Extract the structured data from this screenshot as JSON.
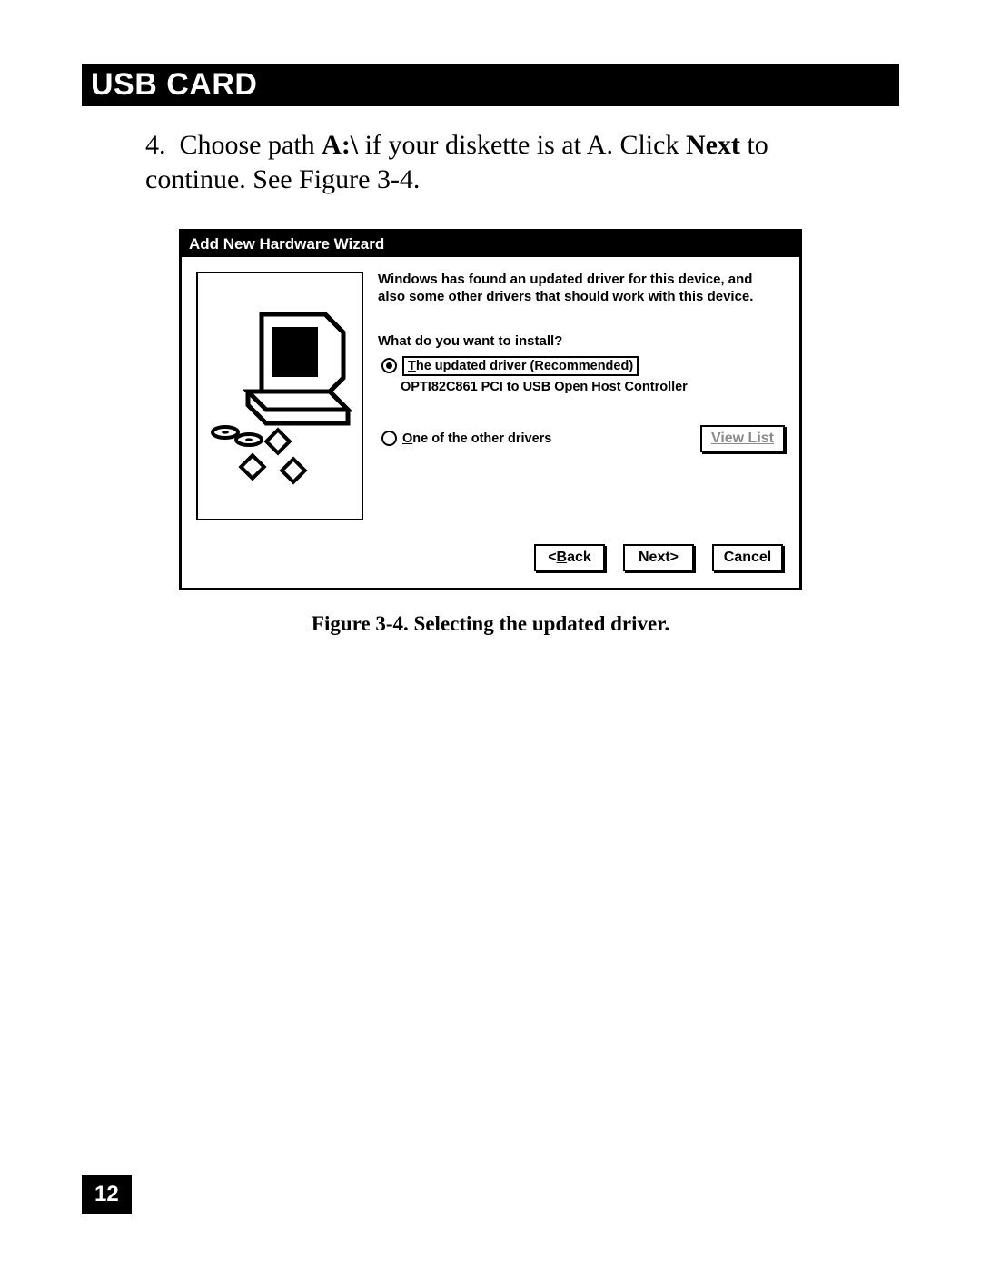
{
  "header": "USB CARD",
  "step": {
    "number": "4.",
    "text_plain_1": "Choose path ",
    "text_bold_1": "A:\\",
    "text_plain_2": " if your diskette is at A. Click ",
    "text_bold_2": "Next",
    "text_plain_3": " to continue. See Figure 3-4."
  },
  "dialog": {
    "title": "Add New Hardware Wizard",
    "found_line1": "Windows has found an updated driver for this device, and",
    "found_line2": "also some other drivers that should work with this device.",
    "question": "What do you want to install?",
    "option1_pre": "T",
    "option1_rest": "he updated driver (Recommended)",
    "option1_sub": "OPTI82C861 PCI to USB Open Host Controller",
    "option2_pre": "O",
    "option2_rest": "ne of the other drivers",
    "view_list": "View List",
    "back_pre": "<",
    "back_ul": "B",
    "back_rest": "ack",
    "next": "Next>",
    "cancel": "Cancel"
  },
  "caption": "Figure 3-4. Selecting the updated driver.",
  "page_number": "12"
}
